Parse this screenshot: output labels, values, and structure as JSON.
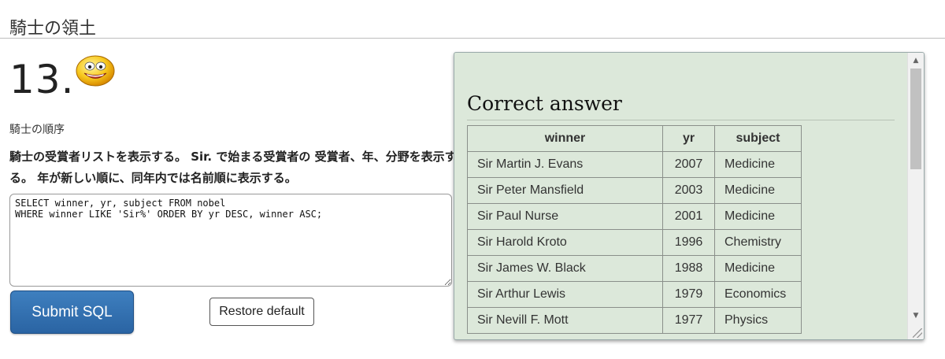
{
  "header": {
    "title": "騎士の領土"
  },
  "question": {
    "number": "13.",
    "subtitle": "騎士の順序",
    "instructions": "騎士の受賞者リストを表示する。 Sir. で始まる受賞者の 受賞者、年、分野を表示する。 年が新しい順に、同年内では名前順に表示する。"
  },
  "editor": {
    "sql": "SELECT winner, yr, subject FROM nobel\nWHERE winner LIKE 'Sir%' ORDER BY yr DESC, winner ASC;"
  },
  "buttons": {
    "submit": "Submit SQL",
    "restore": "Restore default"
  },
  "answer": {
    "title": "Correct answer",
    "columns": [
      "winner",
      "yr",
      "subject"
    ],
    "rows": [
      [
        "Sir Martin J. Evans",
        "2007",
        "Medicine"
      ],
      [
        "Sir Peter Mansfield",
        "2003",
        "Medicine"
      ],
      [
        "Sir Paul Nurse",
        "2001",
        "Medicine"
      ],
      [
        "Sir Harold Kroto",
        "1996",
        "Chemistry"
      ],
      [
        "Sir James W. Black",
        "1988",
        "Medicine"
      ],
      [
        "Sir Arthur Lewis",
        "1979",
        "Economics"
      ],
      [
        "Sir Nevill F. Mott",
        "1977",
        "Physics"
      ]
    ]
  },
  "icons": {
    "smiley": "smiley-face-icon",
    "scroll_up": "scroll-up-icon",
    "scroll_down": "scroll-down-icon",
    "resize": "resize-grip-icon"
  },
  "colors": {
    "submit_bg": "#2a64a3",
    "answer_bg": "#dce8da"
  }
}
